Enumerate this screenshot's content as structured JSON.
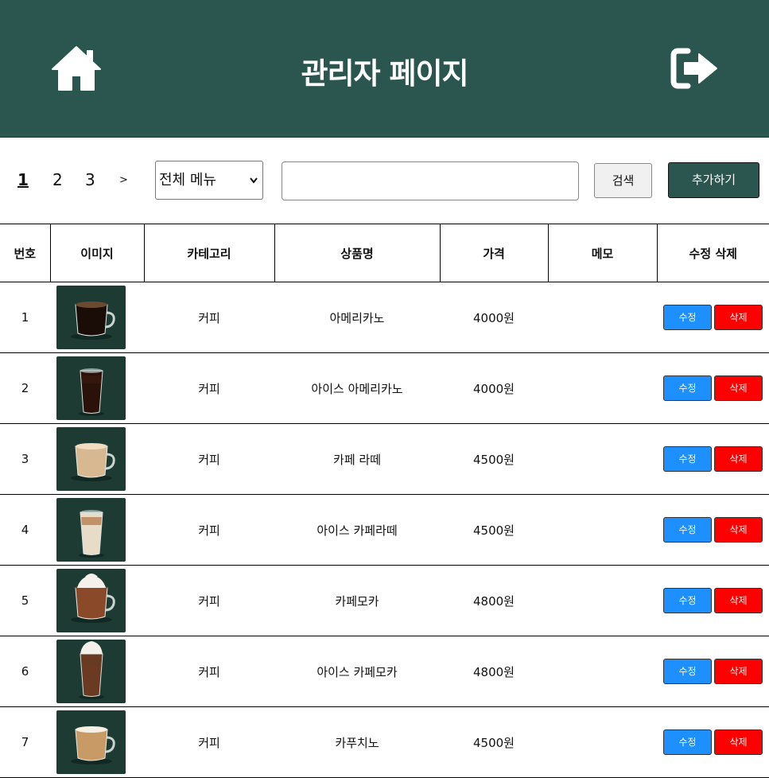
{
  "header": {
    "title": "관리자 페이지",
    "home_icon": "home-icon",
    "logout_icon": "sign-out-icon",
    "bg_color": "#2b564f"
  },
  "toolbar": {
    "pages": [
      "1",
      "2",
      "3"
    ],
    "active_page": "1",
    "next_label": ">",
    "category_select": "전체 메뉴",
    "search_value": "",
    "search_label": "검색",
    "add_label": "추가하기"
  },
  "table": {
    "columns": [
      "번호",
      "이미지",
      "카테고리",
      "상품명",
      "가격",
      "메모",
      "수정 삭제"
    ],
    "edit_label": "수정",
    "delete_label": "삭제",
    "rows": [
      {
        "no": "1",
        "image": "hot-americano",
        "category": "커피",
        "name": "아메리카노",
        "price": "4000원",
        "memo": ""
      },
      {
        "no": "2",
        "image": "iced-americano",
        "category": "커피",
        "name": "아이스 아메리카노",
        "price": "4000원",
        "memo": ""
      },
      {
        "no": "3",
        "image": "hot-latte",
        "category": "커피",
        "name": "카페 라떼",
        "price": "4500원",
        "memo": ""
      },
      {
        "no": "4",
        "image": "iced-latte",
        "category": "커피",
        "name": "아이스 카페라떼",
        "price": "4500원",
        "memo": ""
      },
      {
        "no": "5",
        "image": "hot-mocha",
        "category": "커피",
        "name": "카페모카",
        "price": "4800원",
        "memo": ""
      },
      {
        "no": "6",
        "image": "iced-mocha",
        "category": "커피",
        "name": "아이스 카페모카",
        "price": "4800원",
        "memo": ""
      },
      {
        "no": "7",
        "image": "cappuccino",
        "category": "커피",
        "name": "카푸치노",
        "price": "4500원",
        "memo": ""
      }
    ]
  },
  "colors": {
    "edit_button": "#1e8fff",
    "delete_button": "#ff0000",
    "thumb_bg": "#1d3b33"
  }
}
